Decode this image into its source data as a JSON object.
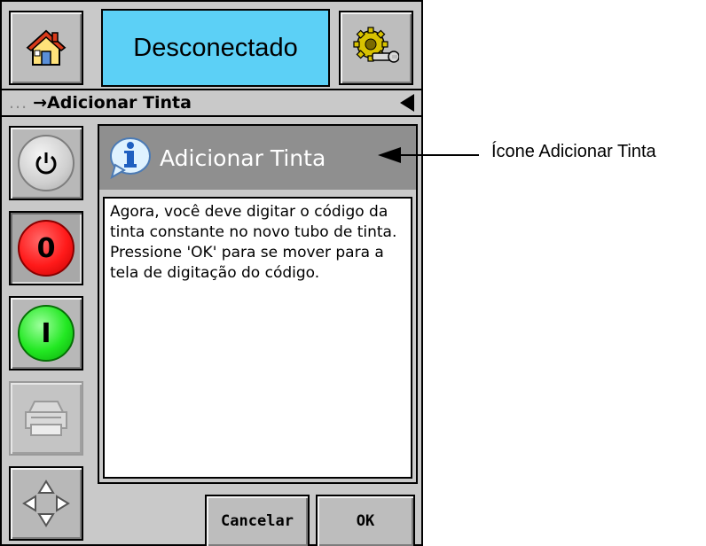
{
  "header": {
    "status_text": "Desconectado",
    "home_icon": "home-icon",
    "settings_icon": "settings-gear-icon"
  },
  "breadcrumb": {
    "prefix": "...",
    "label": "→Adicionar Tinta",
    "back_icon": "back-arrow-icon"
  },
  "sidebar": {
    "buttons": [
      {
        "name": "power",
        "icon": "power-icon",
        "label": ""
      },
      {
        "name": "stop",
        "icon": "stop-icon",
        "label": "0"
      },
      {
        "name": "start",
        "icon": "start-icon",
        "label": "I"
      },
      {
        "name": "print",
        "icon": "printer-icon",
        "label": ""
      },
      {
        "name": "navigate",
        "icon": "navigation-arrows-icon",
        "label": ""
      }
    ]
  },
  "panel": {
    "title": "Adicionar Tinta",
    "title_icon": "info-icon",
    "message": "Agora, você deve digitar o código da tinta constante no novo tubo de tinta. Pressione 'OK' para se mover para a tela de digitação do código."
  },
  "footer": {
    "cancel_label": "Cancelar",
    "ok_label": "OK"
  },
  "annotation": {
    "label": "Ícone Adicionar Tinta"
  },
  "colors": {
    "status_bg": "#5cd0f6",
    "stop_red": "#ff1a1a",
    "start_green": "#22e822",
    "panel_header": "#8f8f8f"
  }
}
